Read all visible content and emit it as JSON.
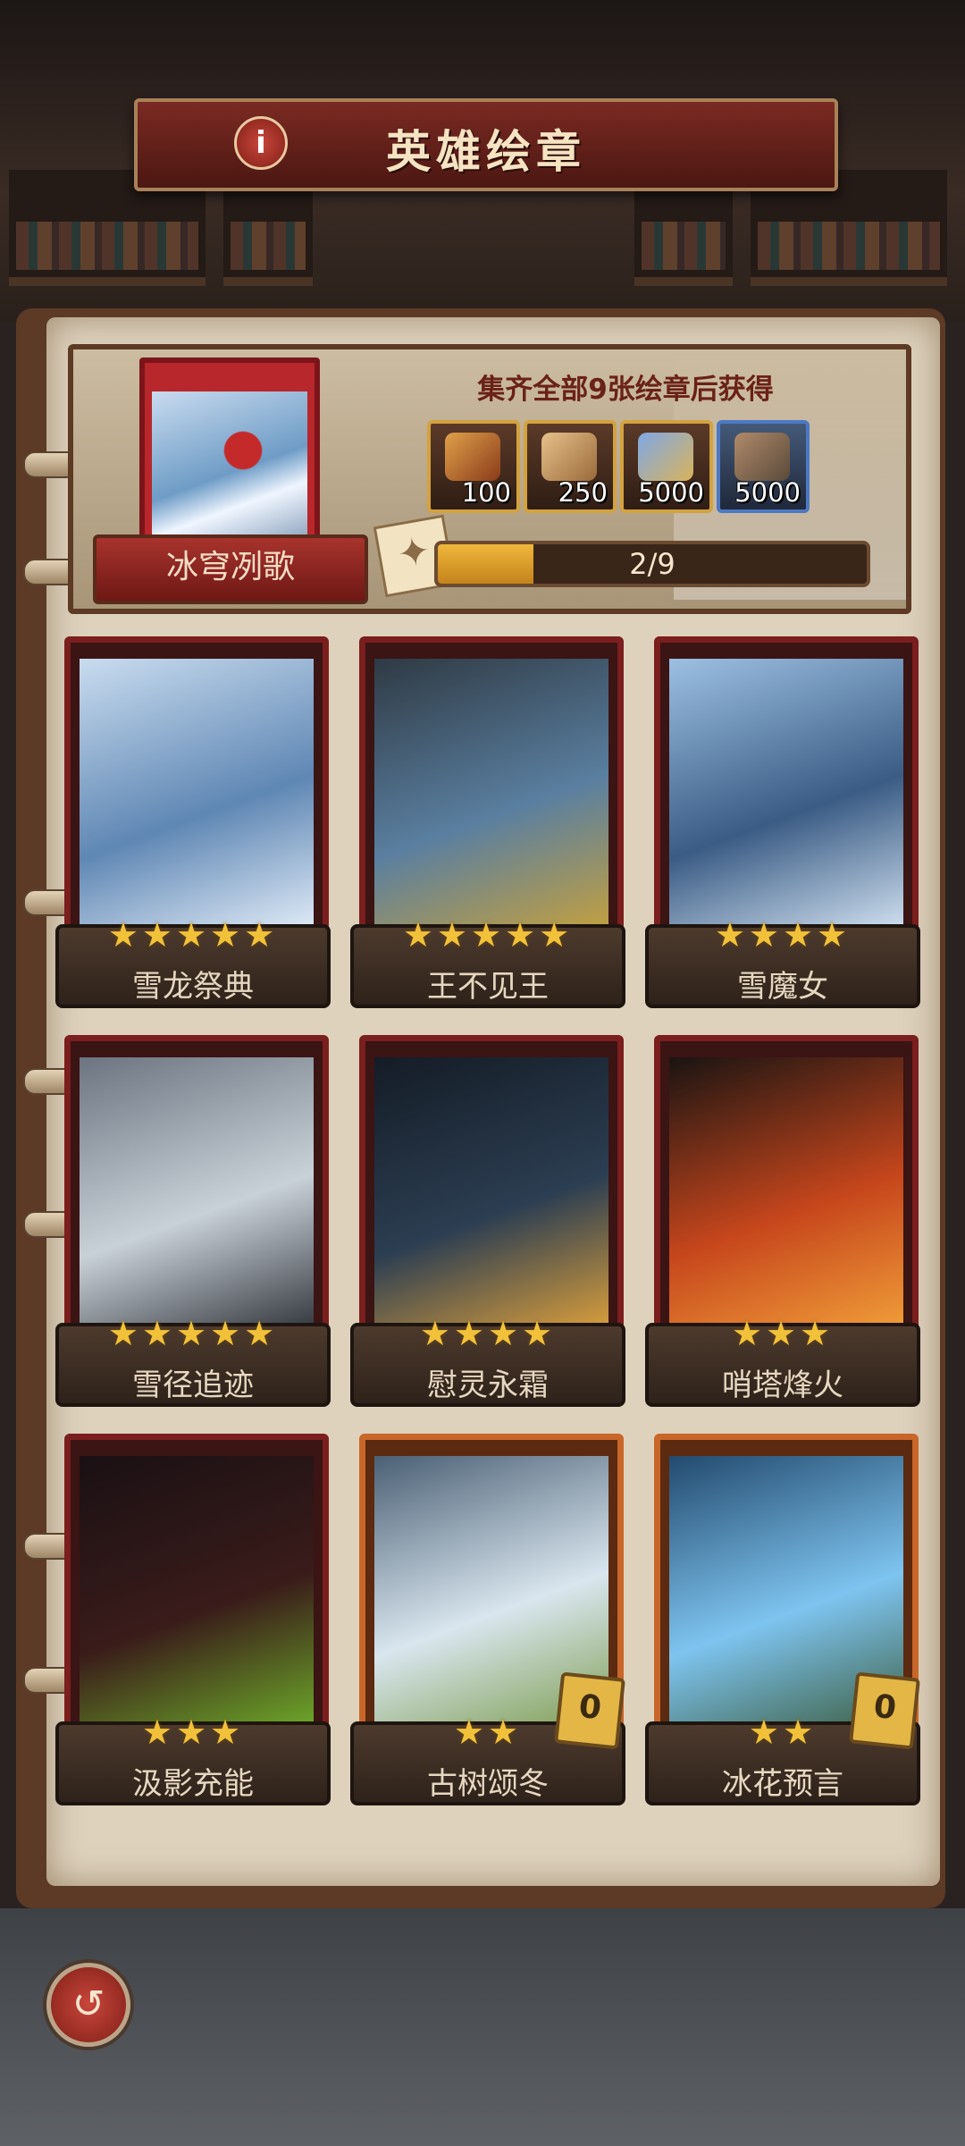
{
  "header": {
    "title": "英雄绘章",
    "info_icon": "i"
  },
  "collection": {
    "name": "冰穹冽歌",
    "collect_text": "集齐全部9张绘章后获得",
    "rewards": [
      {
        "icon": "torch-scroll-icon",
        "count": "100",
        "accent": "#d3a240"
      },
      {
        "icon": "scroll-icon",
        "count": "250",
        "accent": "#d3a240"
      },
      {
        "icon": "potion-icon",
        "count": "5000",
        "accent": "#d3a240"
      },
      {
        "icon": "ore-icon",
        "count": "5000",
        "accent": "#4c79c4"
      }
    ],
    "progress_text": "2/9",
    "progress": 0.222
  },
  "cards": [
    {
      "name": "雪龙祭典",
      "stars": "★★★★★",
      "frame": "red",
      "palette": [
        "#c9dcef",
        "#5f87b4",
        "#e8f1fb"
      ]
    },
    {
      "name": "王不见王",
      "stars": "★★★★★",
      "frame": "red",
      "palette": [
        "#2f3a44",
        "#5a7fa0",
        "#c9a23a"
      ]
    },
    {
      "name": "雪魔女",
      "stars": "★★★★",
      "frame": "red",
      "palette": [
        "#9cc0e2",
        "#3b5c85",
        "#d9e8f6"
      ]
    },
    {
      "name": "雪径追迹",
      "stars": "★★★★★",
      "frame": "red",
      "palette": [
        "#6b7480",
        "#c9d1d8",
        "#2b2f35"
      ]
    },
    {
      "name": "慰灵永霜",
      "stars": "★★★★",
      "frame": "red",
      "palette": [
        "#141c26",
        "#2c3e52",
        "#e3a43a"
      ]
    },
    {
      "name": "哨塔烽火",
      "stars": "★★★",
      "frame": "red",
      "palette": [
        "#1a1412",
        "#c6461c",
        "#f3a23a"
      ]
    },
    {
      "name": "汲影充能",
      "stars": "★★★",
      "frame": "red",
      "palette": [
        "#1a1014",
        "#3a1c1a",
        "#6fb02a"
      ]
    },
    {
      "name": "古树颂冬",
      "stars": "★★",
      "frame": "orange",
      "badge": "0",
      "palette": [
        "#4b6075",
        "#d9e6ef",
        "#7a9a4a"
      ]
    },
    {
      "name": "冰花预言",
      "stars": "★★",
      "frame": "orange",
      "badge": "0",
      "palette": [
        "#234a6e",
        "#7ec4f0",
        "#3a5a3a"
      ]
    }
  ],
  "footer": {
    "back_icon": "↺"
  }
}
